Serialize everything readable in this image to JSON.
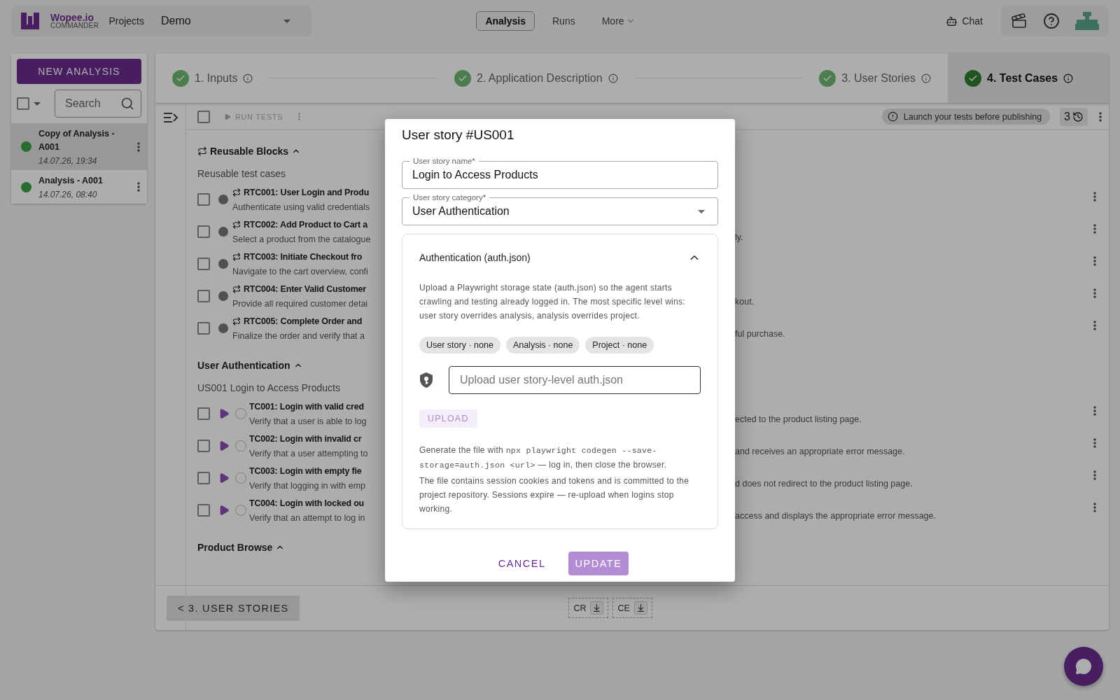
{
  "header": {
    "logo_name": "Wopee.io",
    "logo_sub": "COMMANDER",
    "projects_label": "Projects",
    "project": "Demo",
    "nav": [
      {
        "label": "Analysis",
        "selected": true
      },
      {
        "label": "Runs",
        "selected": false
      },
      {
        "label": "More",
        "selected": false
      }
    ],
    "chat": "Chat"
  },
  "sidebar": {
    "new_button": "NEW ANALYSIS",
    "select_all": {
      "checked": false
    },
    "search_placeholder": "Search",
    "items": [
      {
        "name": "Copy of Analysis - A001",
        "date": "14.07.26, 19:34",
        "selected": true
      },
      {
        "name": "Analysis - A001",
        "date": "14.07.26, 08:40",
        "selected": false
      }
    ]
  },
  "steps": [
    {
      "label": "1. Inputs",
      "completed": true,
      "selected": false
    },
    {
      "label": "2. Application Description",
      "completed": true,
      "selected": false
    },
    {
      "label": "3. User Stories",
      "completed": true,
      "selected": false
    },
    {
      "label": "4. Test Cases",
      "completed": true,
      "selected": true
    }
  ],
  "toolbar": {
    "select_all": {
      "checked": false
    },
    "run_tests": {
      "label": "RUN TESTS",
      "disabled": true
    },
    "notice": "Launch your tests before publishing",
    "history_count": "3"
  },
  "sections": [
    {
      "title": "Reusable Blocks",
      "kind": "reusable",
      "expanded": true,
      "subtitle": "Reusable test cases",
      "items": [
        {
          "kind": "reusable",
          "checked": false,
          "title": "RTC001: User Login and Produ",
          "description": "Authenticate using valid credentials"
        },
        {
          "kind": "reusable",
          "checked": false,
          "title": "RTC002: Add Product to Cart a",
          "description": "Select a product from the catalogue",
          "description_right": "ly."
        },
        {
          "kind": "reusable",
          "checked": false,
          "title": "RTC003: Initiate Checkout fro",
          "description": "Navigate to the cart overview, confi"
        },
        {
          "kind": "reusable",
          "checked": false,
          "title": "RTC004: Enter Valid Customer",
          "description": "Provide all required customer detai",
          "description_right": "kout."
        },
        {
          "kind": "reusable",
          "checked": false,
          "title": "RTC005: Complete Order and",
          "description": "Finalize the order and verify that a",
          "description_right": "ful purchase."
        }
      ]
    },
    {
      "title": "User Authentication",
      "kind": "story",
      "expanded": true,
      "subtitle": "US001 Login to Access Products",
      "items": [
        {
          "kind": "test",
          "checked": false,
          "title": "TC001: Login with valid cred",
          "description": "Verify that a user is able to log",
          "description_right": "ected to the product listing page."
        },
        {
          "kind": "test",
          "checked": false,
          "title": "TC002: Login with invalid cr",
          "description": "Verify that a user attempting to",
          "description_right": "and receives an appropriate error message."
        },
        {
          "kind": "test",
          "checked": false,
          "title": "TC003: Login with empty fie",
          "description": "Verify that logging in with emp",
          "description_right": "d does not redirect to the product listing page."
        },
        {
          "kind": "test",
          "checked": false,
          "title": "TC004: Login with locked ou",
          "description": "Verify that an attempt to log in",
          "description_right": "access and displays the appropriate error message."
        }
      ]
    },
    {
      "title": "Product Browse",
      "kind": "story",
      "expanded": true
    }
  ],
  "footer": {
    "back_button": "< 3. USER STORIES",
    "exports": [
      "CR",
      "CE"
    ]
  },
  "dialog": {
    "title": "User story #US001",
    "name_label": "User story name*",
    "name_value": "Login to Access Products",
    "category_label": "User story category*",
    "category_value": "User Authentication",
    "auth": {
      "title": "Authentication (auth.json)",
      "expanded": true,
      "description": "Upload a Playwright storage state (auth.json) so the agent starts crawling and testing already logged in. The most specific level wins: user story overrides analysis, analysis overrides project.",
      "levels": [
        "User story · none",
        "Analysis · none",
        "Project · none"
      ],
      "file_placeholder": "Upload user story-level auth.json",
      "upload": {
        "label": "UPLOAD",
        "disabled": true
      },
      "help_intro": "Generate the file with",
      "help_code": "npx playwright codegen --save-storage=auth.json <url>",
      "help_outro": "— log in, then close the browser.",
      "note": "The file contains session cookies and tokens and is committed to the project repository. Sessions expire — re-upload when logins stop working."
    },
    "cancel": "CANCEL",
    "update": "UPDATE"
  }
}
